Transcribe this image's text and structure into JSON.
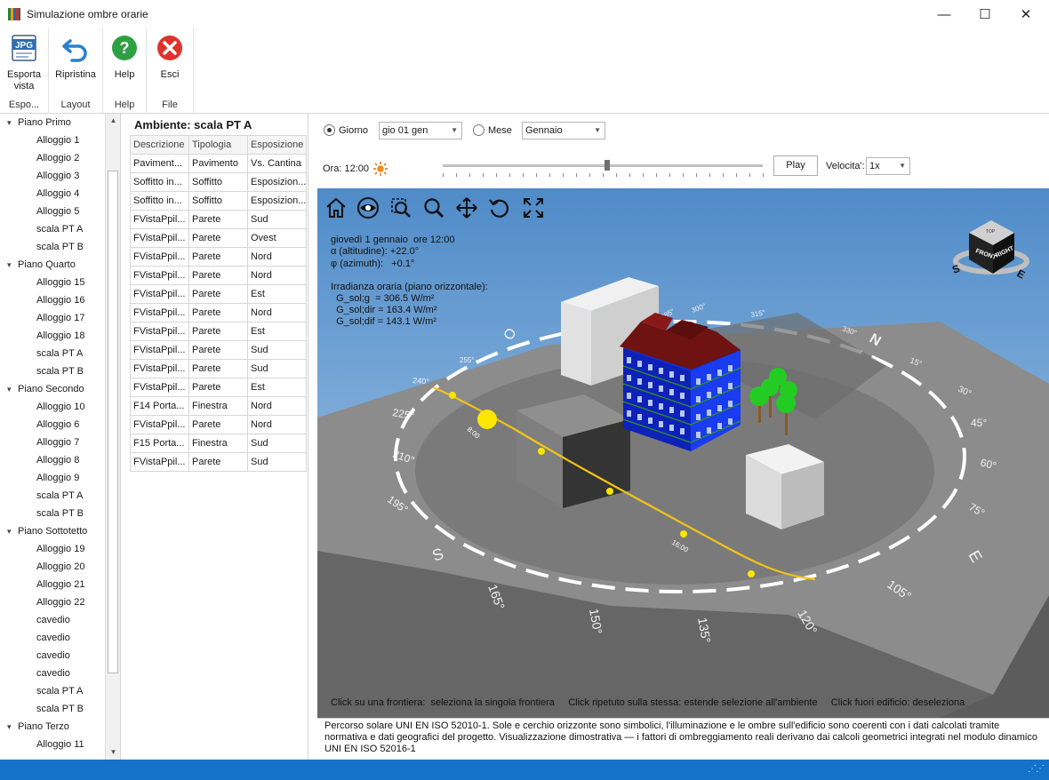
{
  "window": {
    "title": "Simulazione ombre orarie",
    "minimize": "—",
    "maximize": "☐",
    "close": "✕"
  },
  "ribbon": {
    "groups": [
      {
        "label": "Espo...",
        "buttons": [
          {
            "label": "Esporta vista",
            "icon": "jpg-export-icon",
            "badge": "JPG"
          }
        ]
      },
      {
        "label": "Layout",
        "buttons": [
          {
            "label": "Ripristina",
            "icon": "undo-arrow-icon"
          }
        ]
      },
      {
        "label": "Help",
        "buttons": [
          {
            "label": "Help",
            "icon": "help-icon",
            "glyph": "?"
          }
        ]
      },
      {
        "label": "File",
        "buttons": [
          {
            "label": "Esci",
            "icon": "exit-icon",
            "glyph": "✕"
          }
        ]
      }
    ],
    "colors": {
      "jpg": "#2e6db4",
      "undo": "#2a7fcf",
      "help": "#2ea043",
      "exit": "#e0322b"
    }
  },
  "tree": {
    "nodes": [
      {
        "label": "Piano Primo",
        "level": 0
      },
      {
        "label": "Alloggio 1",
        "level": 1
      },
      {
        "label": "Alloggio 2",
        "level": 1
      },
      {
        "label": "Alloggio 3",
        "level": 1
      },
      {
        "label": "Alloggio 4",
        "level": 1
      },
      {
        "label": "Alloggio 5",
        "level": 1
      },
      {
        "label": "scala PT A",
        "level": 1
      },
      {
        "label": "scala PT B",
        "level": 1
      },
      {
        "label": "Piano Quarto",
        "level": 0
      },
      {
        "label": "Alloggio 15",
        "level": 1
      },
      {
        "label": "Alloggio 16",
        "level": 1
      },
      {
        "label": "Alloggio 17",
        "level": 1
      },
      {
        "label": "Alloggio 18",
        "level": 1
      },
      {
        "label": "scala PT A",
        "level": 1
      },
      {
        "label": "scala PT B",
        "level": 1
      },
      {
        "label": "Piano Secondo",
        "level": 0
      },
      {
        "label": "Alloggio 10",
        "level": 1
      },
      {
        "label": "Alloggio 6",
        "level": 1
      },
      {
        "label": "Alloggio 7",
        "level": 1
      },
      {
        "label": "Alloggio 8",
        "level": 1
      },
      {
        "label": "Alloggio 9",
        "level": 1
      },
      {
        "label": "scala PT A",
        "level": 1
      },
      {
        "label": "scala PT B",
        "level": 1
      },
      {
        "label": "Piano Sottotetto",
        "level": 0
      },
      {
        "label": "Alloggio 19",
        "level": 1
      },
      {
        "label": "Alloggio 20",
        "level": 1
      },
      {
        "label": "Alloggio 21",
        "level": 1
      },
      {
        "label": "Alloggio 22",
        "level": 1
      },
      {
        "label": "cavedio",
        "level": 1
      },
      {
        "label": "cavedio",
        "level": 1
      },
      {
        "label": "cavedio",
        "level": 1
      },
      {
        "label": "cavedio",
        "level": 1
      },
      {
        "label": "scala PT A",
        "level": 1
      },
      {
        "label": "scala PT B",
        "level": 1
      },
      {
        "label": "Piano Terzo",
        "level": 0
      },
      {
        "label": "Alloggio 11",
        "level": 1
      }
    ]
  },
  "panel": {
    "title": "Ambiente: scala PT A",
    "columns": [
      "Descrizione",
      "Tipologia",
      "Esposizione"
    ],
    "rows": [
      [
        "Paviment...",
        "Pavimento",
        "Vs. Cantina"
      ],
      [
        "Soffitto in...",
        "Soffitto",
        "Esposizion..."
      ],
      [
        "Soffitto in...",
        "Soffitto",
        "Esposizion..."
      ],
      [
        "FVistaPpil...",
        "Parete",
        "Sud"
      ],
      [
        "FVistaPpil...",
        "Parete",
        "Ovest"
      ],
      [
        "FVistaPpil...",
        "Parete",
        "Nord"
      ],
      [
        "FVistaPpil...",
        "Parete",
        "Nord"
      ],
      [
        "FVistaPpil...",
        "Parete",
        "Est"
      ],
      [
        "FVistaPpil...",
        "Parete",
        "Nord"
      ],
      [
        "FVistaPpil...",
        "Parete",
        "Est"
      ],
      [
        "FVistaPpil...",
        "Parete",
        "Sud"
      ],
      [
        "FVistaPpil...",
        "Parete",
        "Sud"
      ],
      [
        "FVistaPpil...",
        "Parete",
        "Est"
      ],
      [
        "F14 Porta...",
        "Finestra",
        "Nord"
      ],
      [
        "FVistaPpil...",
        "Parete",
        "Nord"
      ],
      [
        "F15 Porta...",
        "Finestra",
        "Sud"
      ],
      [
        "FVistaPpil...",
        "Parete",
        "Sud"
      ]
    ]
  },
  "controls": {
    "giorno_label": "Giorno",
    "giorno_value": "gio 01 gen",
    "mese_label": "Mese",
    "mese_value": "Gennaio",
    "ora_label": "Ora: 12:00",
    "sun_icon": "sun-icon",
    "slider_value": 0.5,
    "play_label": "Play",
    "velocita_label": "Velocita':",
    "velocita_value": "1x",
    "mode": "giorno"
  },
  "viewport": {
    "toolbar": [
      "home-icon",
      "orbit-eye-icon",
      "zoom-window-icon",
      "zoom-icon",
      "pan-icon",
      "rotate-icon",
      "fit-all-icon"
    ],
    "info": {
      "date_line": "giovedì 1 gennaio  ore 12:00",
      "altitude_line": "α (altitudine): +22.0°",
      "azimuth_line": "φ (azimuth):   +0.1°",
      "irr_title": "Irradianza oraria (piano orizzontale):",
      "g_line": "  G_sol;g  = 306.5 W/m²",
      "dir_line": "  G_sol;dir = 163.4 W/m²",
      "dif_line": "  G_sol;dif = 143.1 W/m²"
    },
    "hint": "Click su una frontiera:  seleziona la singola frontiera     Click ripetuto sulla stessa: estende selezione all'ambiente     Click fuori edificio: deseleziona",
    "compass": {
      "north": "N",
      "east": "E",
      "south": "S",
      "west": "O",
      "degrees": [
        "45°",
        "60°",
        "75°",
        "105°",
        "120°",
        "135°",
        "150°",
        "165°",
        "195°",
        "210°",
        "225°",
        "240°",
        "255°",
        "285°",
        "300°",
        "315°",
        "330°",
        "15°",
        "30°"
      ]
    },
    "path_labels": [
      "8:00",
      "16:00"
    ],
    "viewcube": {
      "front": "FRONT",
      "right": "RIGHT",
      "top": "TOP",
      "s": "S",
      "e": "E"
    },
    "colors": {
      "sky": "#5a93cc",
      "ground": "#8a8a8a",
      "sun": "#ffe600",
      "path": "#f2c318",
      "facade": "#1030d8",
      "roof": "#7a1414",
      "tree": "#22cc22",
      "status": "#1473c9"
    }
  },
  "info_text": "Percorso solare UNI EN ISO 52010-1. Sole e cerchio orizzonte sono simbolici, l'illuminazione e le ombre sull'edificio sono coerenti con i dati calcolati tramite normativa e dati geografici del progetto. Visualizzazione dimostrativa — i fattori di ombreggiamento reali derivano dai calcoli geometrici integrati nel modulo dinamico UNI EN ISO 52016-1"
}
